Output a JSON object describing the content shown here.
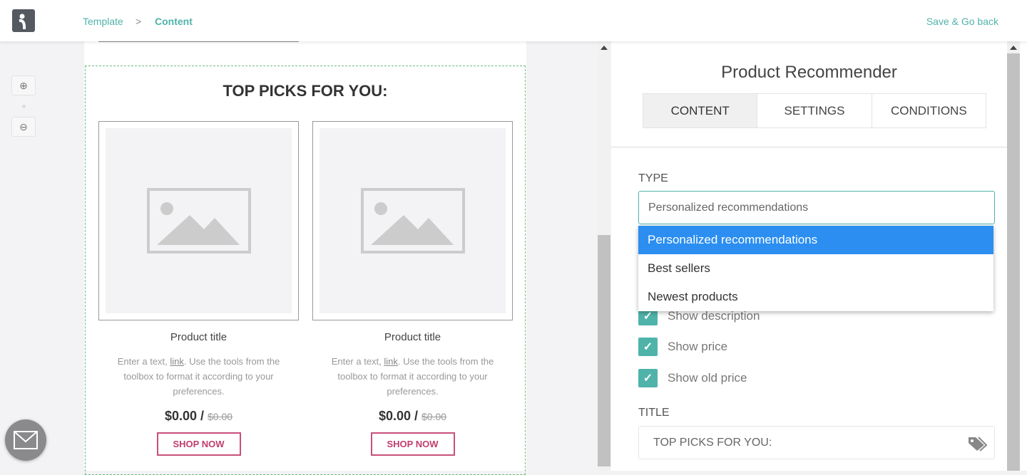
{
  "header": {
    "breadcrumb": [
      "Template",
      "Content"
    ],
    "save_label": "Save & Go back"
  },
  "canvas": {
    "heading": "TOP PICKS FOR YOU:",
    "products": [
      {
        "title": "Product title",
        "desc_pre": "Enter a text, ",
        "desc_link": "link",
        "desc_post": ". Use the tools from the toolbox to format it according to your preferences.",
        "price": "$0.00",
        "separator": " / ",
        "old_price": "$0.00",
        "button": "SHOP NOW"
      },
      {
        "title": "Product title",
        "desc_pre": "Enter a text, ",
        "desc_link": "link",
        "desc_post": ". Use the tools from the toolbox to format it according to your preferences.",
        "price": "$0.00",
        "separator": " / ",
        "old_price": "$0.00",
        "button": "SHOP NOW"
      }
    ]
  },
  "panel": {
    "title": "Product Recommender",
    "tabs": [
      {
        "label": "CONTENT",
        "active": true
      },
      {
        "label": "SETTINGS"
      },
      {
        "label": "CONDITIONS"
      }
    ],
    "type_label": "TYPE",
    "type_value": "Personalized recommendations",
    "type_options": [
      "Personalized recommendations",
      "Best sellers",
      "Newest products"
    ],
    "checkboxes": [
      {
        "label": "Show description",
        "checked": true
      },
      {
        "label": "Show price",
        "checked": true
      },
      {
        "label": "Show old price",
        "checked": true
      }
    ],
    "title_label": "TITLE",
    "title_value": "TOP PICKS FOR YOU:"
  },
  "colors": {
    "accent": "#4fb3aa",
    "button": "#c03d6e",
    "selected": "#2b8ef0"
  }
}
